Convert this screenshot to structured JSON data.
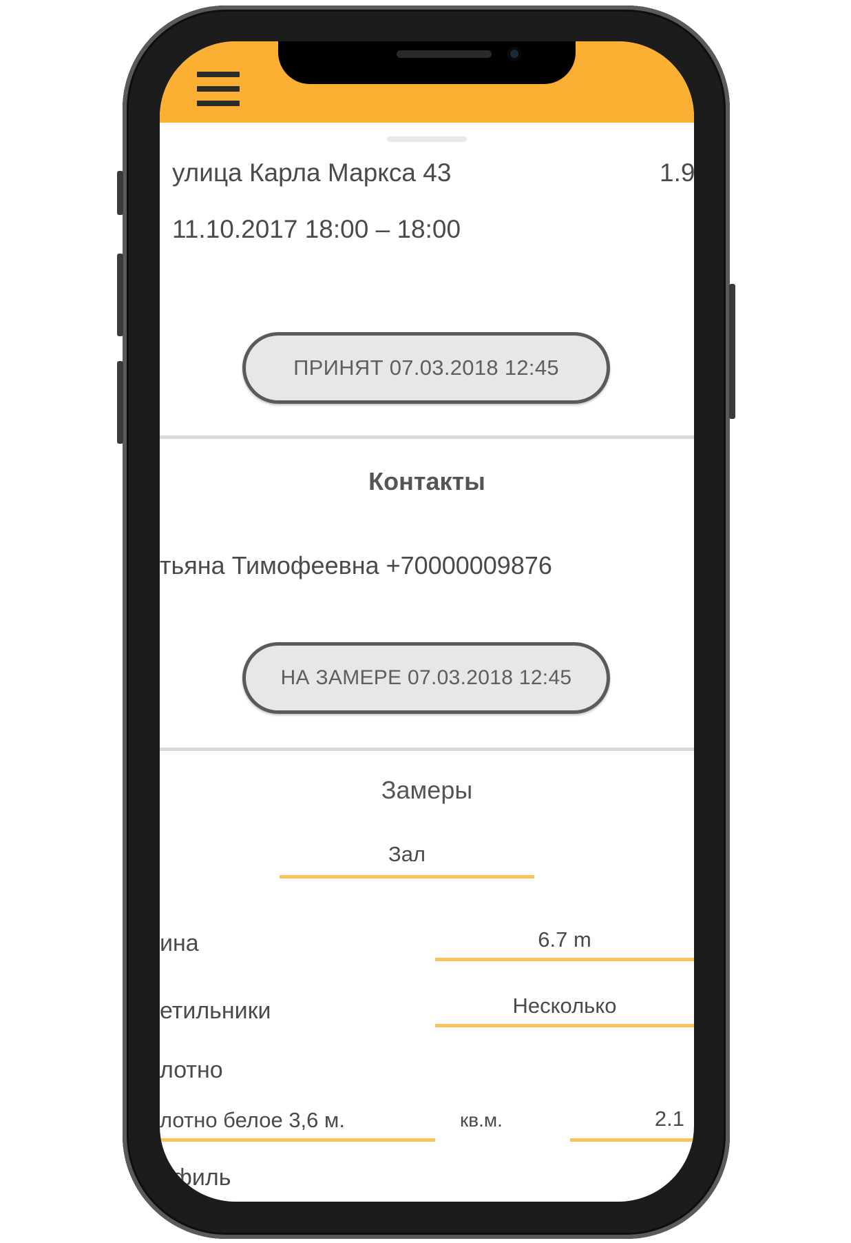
{
  "header": {
    "menu_icon": "hamburger-menu-icon",
    "accent_color": "#fbb034"
  },
  "order": {
    "address": "улица Карла Маркса 43",
    "distance": "1.9",
    "datetime": "11.10.2017 18:00 – 18:00",
    "accepted_label": "ПРИНЯТ 07.03.2018 12:45"
  },
  "contacts": {
    "title": "Контакты",
    "person": "тьяна Тимофеевна +70000009876",
    "status_label": "НА ЗАМЕРЕ 07.03.2018 12:45"
  },
  "measurements": {
    "title": "Замеры",
    "room_value": "Зал",
    "length_label": "ина",
    "length_value": "6.7 m",
    "lamps_label": "етильники",
    "lamps_value": "Несколько",
    "canvas_label": "лотно",
    "canvas_value": "лотно белое 3,6 м.",
    "unit_label": "кв.м.",
    "area_value": "2.1",
    "profile_label": "офиль"
  }
}
